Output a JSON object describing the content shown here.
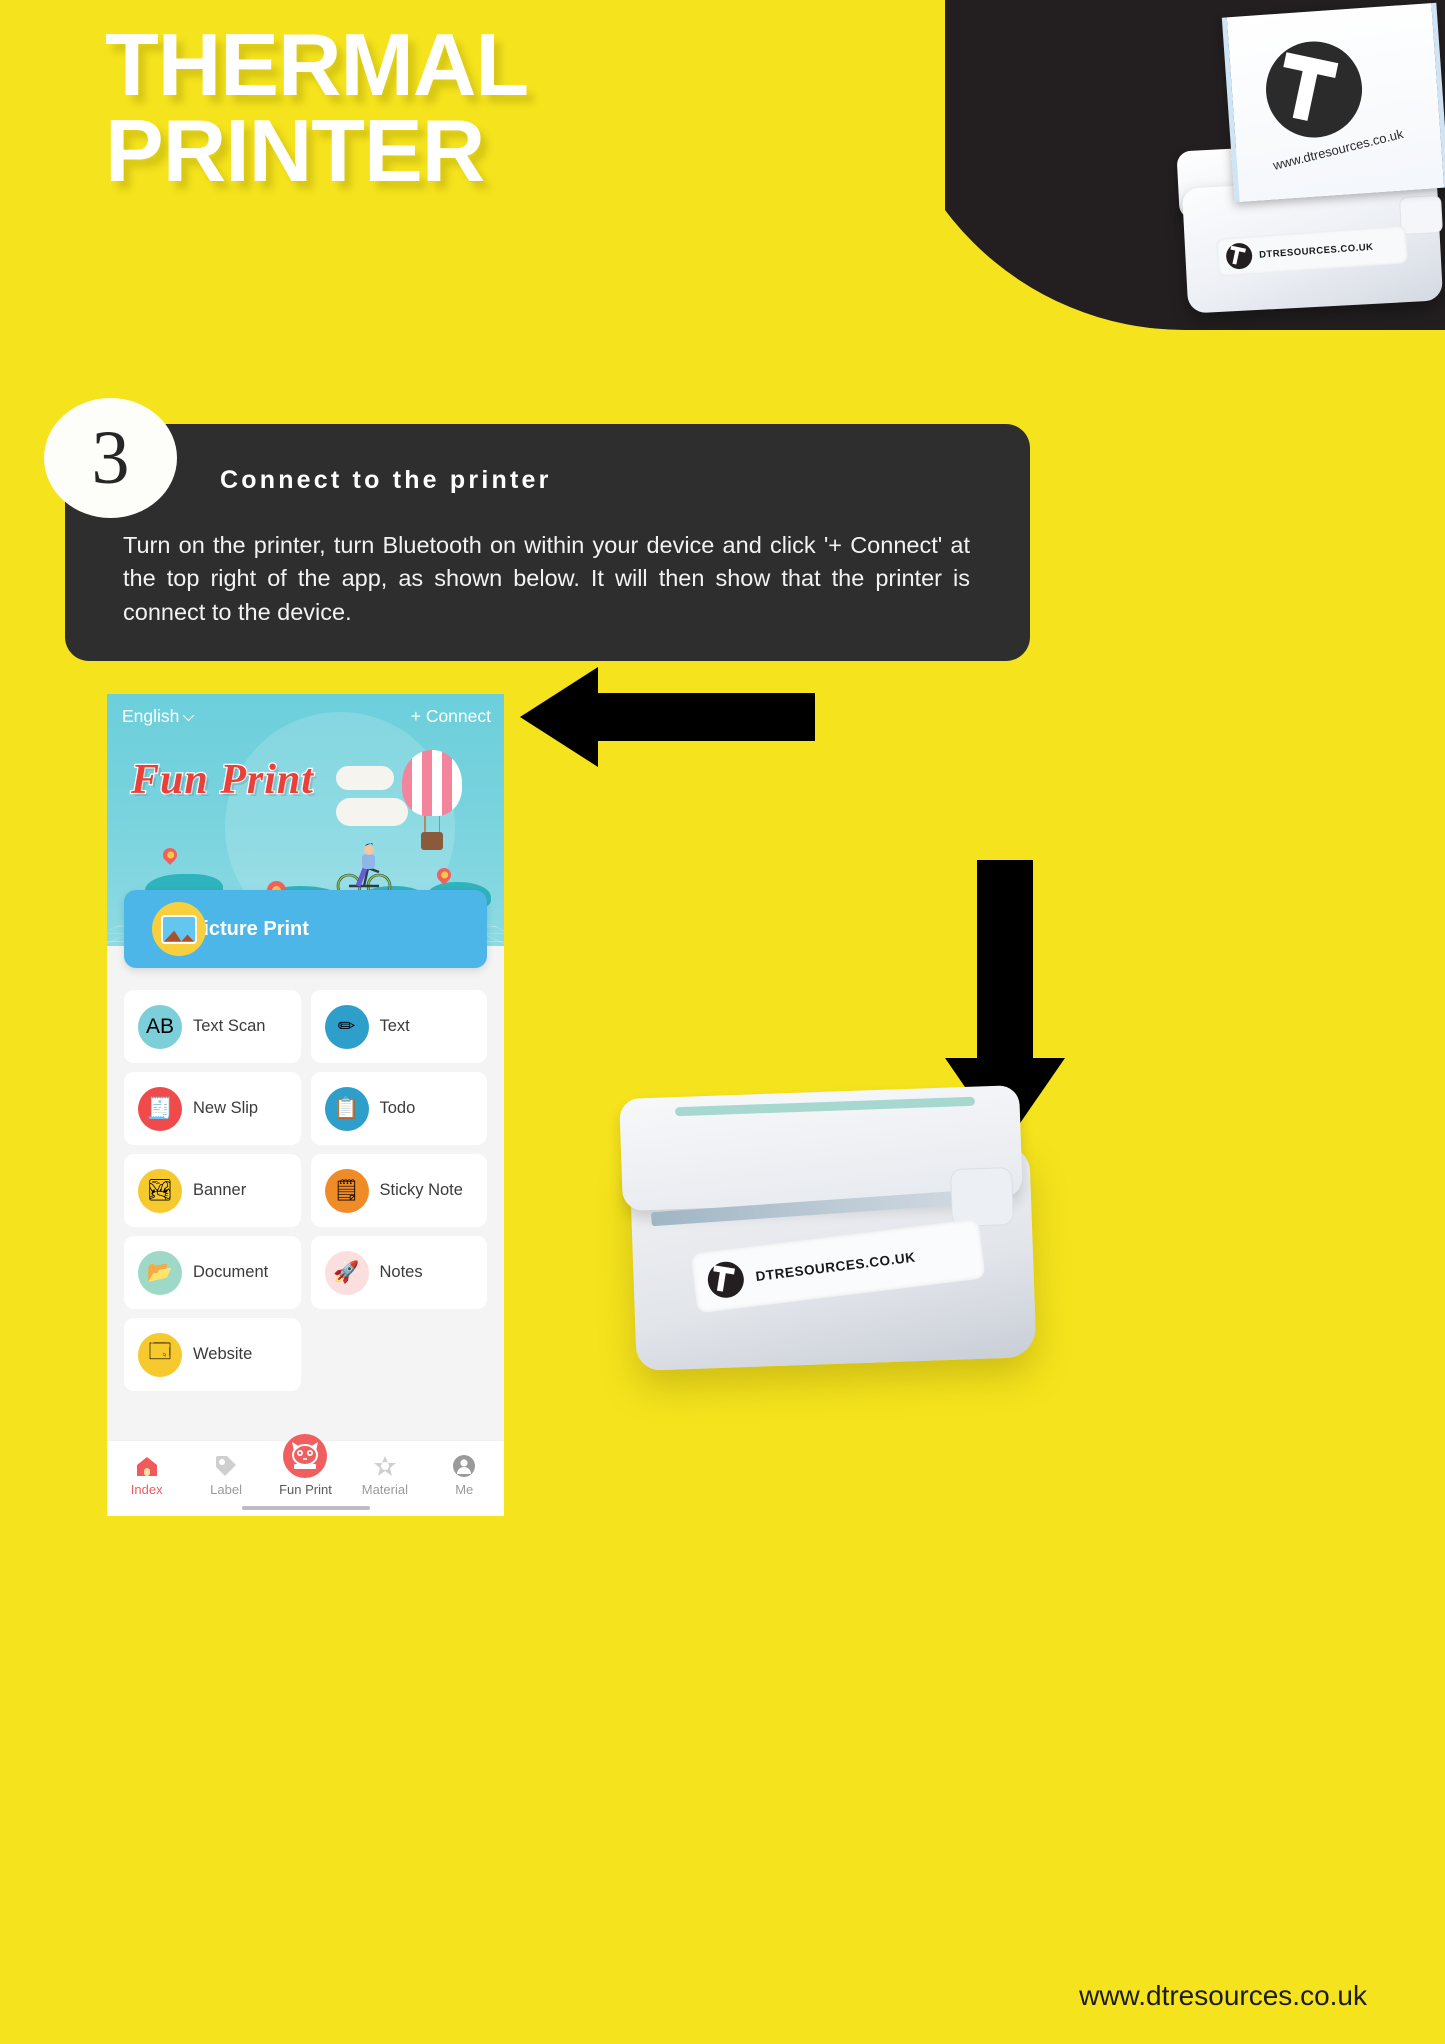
{
  "poster": {
    "title_line1": "THERMAL",
    "title_line2": "PRINTER",
    "footer_url": "www.dtresources.co.uk"
  },
  "step": {
    "number": "3",
    "heading": "Connect to the printer",
    "body": "Turn on the printer, turn Bluetooth on within your device and click '+ Connect' at the top right of the app, as shown below. It will then show that the printer is connect to the device."
  },
  "photos": {
    "top": {
      "receipt_url": "www.dtresources.co.uk",
      "device_label": "DTRESOURCES.CO.UK",
      "logo": "dt-logo-icon"
    },
    "bottom": {
      "device_label": "DTRESOURCES.CO.UK",
      "logo": "dt-logo-icon"
    }
  },
  "arrows": {
    "left_arrow": "arrow-left-icon",
    "down_arrow": "arrow-down-icon"
  },
  "app": {
    "topbar": {
      "language": "English",
      "language_chevron": "chevron-down-icon",
      "connect_label": "+ Connect"
    },
    "hero": {
      "brand": "Fun Print",
      "art": [
        "hot-air-balloon",
        "cyclist",
        "world-map",
        "clouds",
        "map-pins"
      ]
    },
    "primary_action": {
      "label": "Picture Print",
      "icon": "picture-icon"
    },
    "tiles": [
      {
        "label": "Text Scan",
        "icon": "translate-chat-icon",
        "icon_bg": "#7ccfd8",
        "glyph": "AB"
      },
      {
        "label": "Text",
        "icon": "pencil-icon",
        "icon_bg": "#2e9ecb",
        "glyph": "✏"
      },
      {
        "label": "New Slip",
        "icon": "receipt-icon",
        "icon_bg": "#ef4b4b",
        "glyph": "🧾"
      },
      {
        "label": "Todo",
        "icon": "clipboard-icon",
        "icon_bg": "#2e9ecb",
        "glyph": "📋"
      },
      {
        "label": "Banner",
        "icon": "banner-board-icon",
        "icon_bg": "#f6c92e",
        "glyph": "🏞"
      },
      {
        "label": "Sticky Note",
        "icon": "sticky-note-icon",
        "icon_bg": "#f08c28",
        "glyph": "🗒"
      },
      {
        "label": "Document",
        "icon": "folder-icon",
        "icon_bg": "#9ed9c8",
        "glyph": "📂"
      },
      {
        "label": "Notes",
        "icon": "rocket-icon",
        "icon_bg": "#fbdede",
        "glyph": "🚀"
      },
      {
        "label": "Website",
        "icon": "browser-window-icon",
        "icon_bg": "#f6c92e",
        "glyph": "🗔"
      }
    ],
    "nav": [
      {
        "label": "Index",
        "icon": "home-icon",
        "active": true
      },
      {
        "label": "Label",
        "icon": "tag-icon",
        "active": false
      },
      {
        "label": "Fun Print",
        "icon": "cat-icon",
        "active": false
      },
      {
        "label": "Material",
        "icon": "star-icon",
        "active": false
      },
      {
        "label": "Me",
        "icon": "person-icon",
        "active": false
      }
    ]
  },
  "colors": {
    "background": "#f5e31d",
    "card": "#2e2e2e",
    "accent_red": "#ef5b5b",
    "hero_cyan": "#78d3de",
    "banner_blue": "#4db6e8"
  }
}
